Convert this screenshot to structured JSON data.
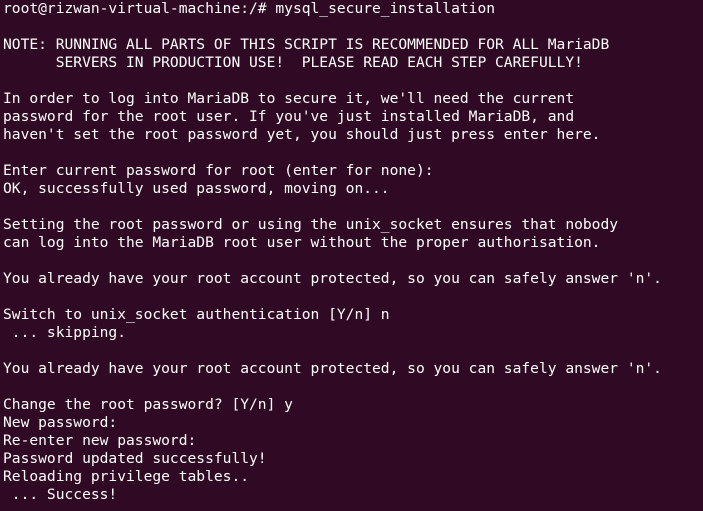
{
  "terminal": {
    "lines": [
      "root@rizwan-virtual-machine:/# mysql_secure_installation",
      "",
      "NOTE: RUNNING ALL PARTS OF THIS SCRIPT IS RECOMMENDED FOR ALL MariaDB",
      "      SERVERS IN PRODUCTION USE!  PLEASE READ EACH STEP CAREFULLY!",
      "",
      "In order to log into MariaDB to secure it, we'll need the current",
      "password for the root user. If you've just installed MariaDB, and",
      "haven't set the root password yet, you should just press enter here.",
      "",
      "Enter current password for root (enter for none):",
      "OK, successfully used password, moving on...",
      "",
      "Setting the root password or using the unix_socket ensures that nobody",
      "can log into the MariaDB root user without the proper authorisation.",
      "",
      "You already have your root account protected, so you can safely answer 'n'.",
      "",
      "Switch to unix_socket authentication [Y/n] n",
      " ... skipping.",
      "",
      "You already have your root account protected, so you can safely answer 'n'.",
      "",
      "Change the root password? [Y/n] y",
      "New password:",
      "Re-enter new password:",
      "Password updated successfully!",
      "Reloading privilege tables..",
      " ... Success!"
    ]
  }
}
